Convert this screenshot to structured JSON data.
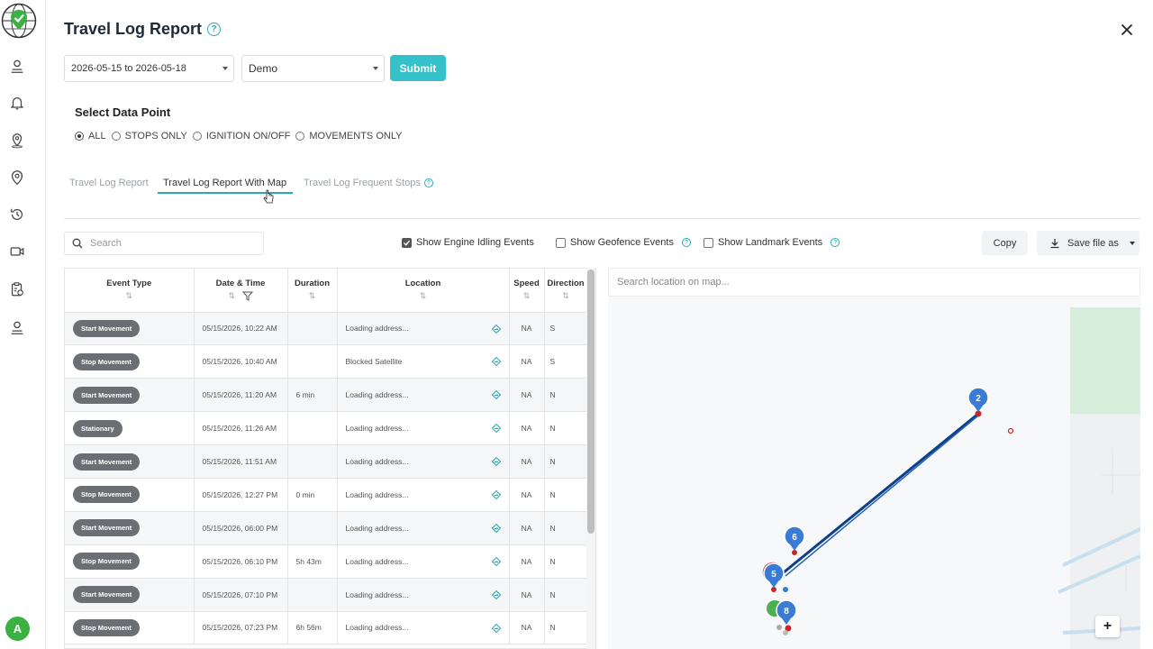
{
  "header": {
    "title": "Travel Log Report",
    "date_range": "2026-05-15 to 2026-05-18",
    "vehicle": "Demo",
    "submit_label": "Submit"
  },
  "data_point": {
    "title": "Select Data Point",
    "options": [
      "ALL",
      "STOPS ONLY",
      "IGNITION ON/OFF",
      "MOVEMENTS ONLY"
    ],
    "selected": "ALL"
  },
  "tabs": [
    "Travel Log Report",
    "Travel Log Report With Map",
    "Travel Log Frequent Stops"
  ],
  "active_tab": "Travel Log Report With Map",
  "toolbar": {
    "search_placeholder": "Search",
    "show_engine_idling": "Show Engine Idling Events",
    "show_geofence": "Show Geofence Events",
    "show_landmark": "Show Landmark Events",
    "copy_label": "Copy",
    "save_label": "Save file as"
  },
  "table": {
    "columns": [
      "Event Type",
      "Date & Time",
      "Duration",
      "Location",
      "Speed",
      "Direction"
    ],
    "rows": [
      {
        "event": "Start Movement",
        "datetime": "05/15/2026, 10:22 AM",
        "duration": "",
        "location": "Loading address...",
        "speed": "NA",
        "direction": "S"
      },
      {
        "event": "Stop Movement",
        "datetime": "05/15/2026, 10:40 AM",
        "duration": "",
        "location": "Blocked Satellite",
        "speed": "NA",
        "direction": "S"
      },
      {
        "event": "Start Movement",
        "datetime": "05/15/2026, 11:20 AM",
        "duration": "6 min",
        "location": "Loading address...",
        "speed": "NA",
        "direction": "N"
      },
      {
        "event": "Stationary",
        "datetime": "05/15/2026, 11:26 AM",
        "duration": "",
        "location": "Loading address...",
        "speed": "NA",
        "direction": "N"
      },
      {
        "event": "Start Movement",
        "datetime": "05/15/2026, 11:51 AM",
        "duration": "",
        "location": "Loading address...",
        "speed": "NA",
        "direction": "N"
      },
      {
        "event": "Stop Movement",
        "datetime": "05/15/2026, 12:27 PM",
        "duration": "0 min",
        "location": "Loading address...",
        "speed": "NA",
        "direction": "N"
      },
      {
        "event": "Start Movement",
        "datetime": "05/15/2026, 06:00 PM",
        "duration": "",
        "location": "Loading address...",
        "speed": "NA",
        "direction": "N"
      },
      {
        "event": "Stop Movement",
        "datetime": "05/15/2026, 06:10 PM",
        "duration": "5h 43m",
        "location": "Loading address...",
        "speed": "NA",
        "direction": "N"
      },
      {
        "event": "Start Movement",
        "datetime": "05/15/2026, 07:10 PM",
        "duration": "",
        "location": "Loading address...",
        "speed": "NA",
        "direction": "N"
      },
      {
        "event": "Stop Movement",
        "datetime": "05/15/2026, 07:23 PM",
        "duration": "6h 56m",
        "location": "Loading address...",
        "speed": "NA",
        "direction": "N"
      }
    ]
  },
  "map": {
    "search_placeholder": "Search location on map...",
    "markers": [
      "2",
      "6",
      "5",
      "8"
    ],
    "zoom_in": "+"
  },
  "user": {
    "avatar_initial": "A"
  },
  "colors": {
    "accent": "#35c1c9",
    "route": "#0d3f8a",
    "marker": "#3a7bd5",
    "pill": "#6b6f73"
  }
}
